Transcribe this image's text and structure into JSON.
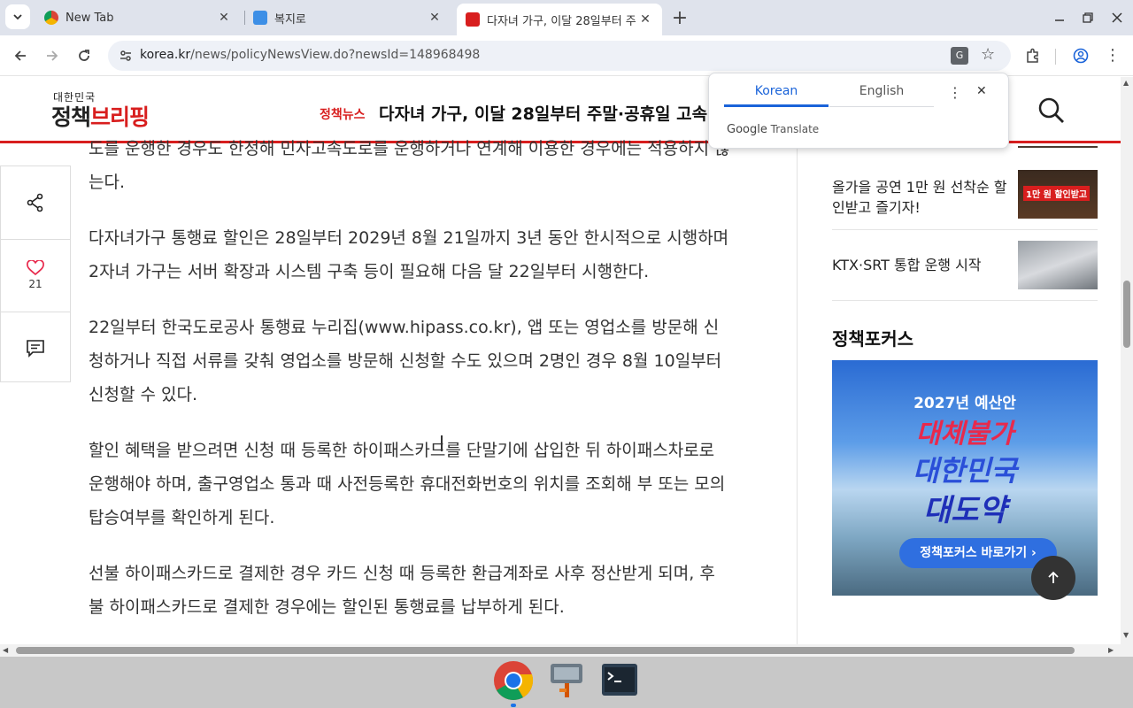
{
  "browser": {
    "tabs": [
      {
        "title": "New Tab"
      },
      {
        "title": "복지로"
      },
      {
        "title": "다자녀 가구, 이달 28일부터 주"
      }
    ],
    "new_tab": "+",
    "url_host": "korea.kr",
    "url_path": "/news/policyNewsView.do?newsId=148968498"
  },
  "translate": {
    "source_lang": "Korean",
    "target_lang": "English",
    "brand_google": "Google",
    "brand_translate": "Translate"
  },
  "site": {
    "logo_small": "대한민국",
    "logo_big_a": "정책",
    "logo_big_b": "브리핑",
    "category": "정책뉴스",
    "header_title": "다자녀 가구, 이달 28일부터 주말·공휴일 고속"
  },
  "share": {
    "like_count": "21"
  },
  "article": {
    "paragraphs": [
      "도를 운행한 경우도 한정해 민자고속도로를 운행하거나 연계해 이용한 경우에는 적용하지 않는다.",
      "다자녀가구 통행료 할인은 28일부터 2029년 8월 21일까지 3년 동안 한시적으로 시행하며 2자녀 가구는 서버 확장과 시스템 구축 등이 필요해 다음 달 22일부터 시행한다.",
      "22일부터 한국도로공사 통행료 누리집(www.hipass.co.kr), 앱 또는 영업소를 방문해 신청하거나 직접 서류를 갖춰 영업소를 방문해 신청할 수도 있으며 2명인 경우 8월 10일부터 신청할 수 있다.",
      "할인 혜택을 받으려면 신청 때 등록한 하이패스카드를 단말기에 삽입한 뒤 하이패스차로로 운행해야 하며, 출구영업소 통과 때 사전등록한 휴대전화번호의 위치를 조회해 부 또는 모의 탑승여부를 확인하게 된다.",
      "선불 하이패스카드로 결제한 경우 카드 신청 때 등록한 환급계좌로 사후 정산받게 되며, 후불 하이패스카드로 결제한 경우에는 할인된 통행료를 납부하게 된다."
    ]
  },
  "sidebar": {
    "items": [
      {
        "text": "올가을 공연 1만 원 선착순 할인받고 즐기자!",
        "thumb_text": "1만 원 할인받고"
      },
      {
        "text": "KTX·SRT 통합 운행 시작"
      }
    ],
    "focus_title": "정책포커스",
    "banner": {
      "line1": "2027년 예산안",
      "line2": "대체불가",
      "line3": "대한민국",
      "line4": "대도약",
      "button": "정책포커스 바로가기 ›"
    }
  },
  "colors": {
    "brand_red": "#d81e1e",
    "link_blue": "#1a63d9",
    "tab_strip": "#dfe3ec"
  }
}
